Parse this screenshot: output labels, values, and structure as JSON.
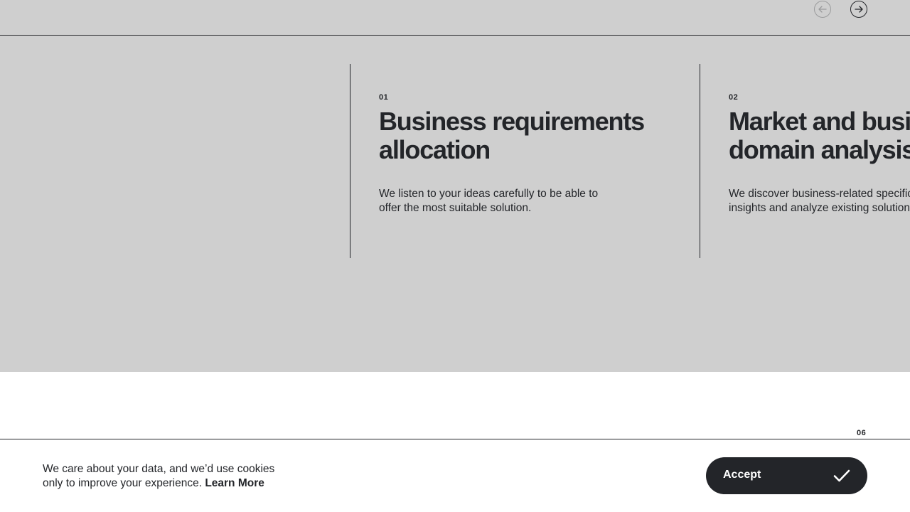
{
  "slider": {
    "prev_icon": "arrow-left-circle-icon",
    "next_icon": "arrow-right-circle-icon",
    "cards": [
      {
        "number": "01",
        "title": "Business requirements\nallocation",
        "description": "We listen to your ideas carefully to be able to\noffer the most suitable solution."
      },
      {
        "number": "02",
        "title": "Market and business\ndomain analysis",
        "description": "We discover business-related specific\ninsights and analyze existing solutions"
      }
    ]
  },
  "counter": "06",
  "cookie": {
    "text": "We care about your data, and we’d use cookies only to improve your experience. ",
    "learn_more": "Learn More",
    "accept_label": "Accept",
    "accept_icon": "checkmark-icon"
  },
  "colors": {
    "section_bg": "#cfcfcf",
    "text": "#232529",
    "button_bg": "#232529",
    "page_bg": "#ffffff"
  }
}
